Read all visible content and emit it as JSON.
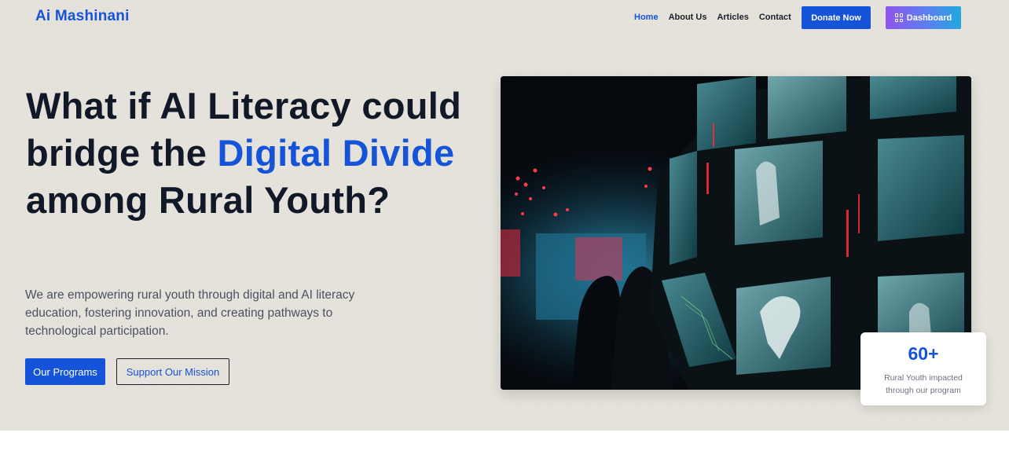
{
  "brand": {
    "name": "Ai Mashinani"
  },
  "nav": {
    "items": [
      {
        "label": "Home",
        "active": true
      },
      {
        "label": "About Us"
      },
      {
        "label": "Articles"
      },
      {
        "label": "Contact"
      }
    ],
    "donate_label": "Donate Now",
    "dashboard_label": "Dashboard"
  },
  "hero": {
    "headline_part1": "What if AI Literacy could bridge the ",
    "headline_highlight": "Digital Divide",
    "headline_part2": " among Rural Youth?",
    "subtext": "We are empowering rural youth through digital and AI literacy education, fostering innovation, and creating pathways to technological participation.",
    "primary_cta": "Our Programs",
    "secondary_cta": "Support Our Mission"
  },
  "stat": {
    "value": "60+",
    "label": "Rural Youth impacted through our program"
  },
  "colors": {
    "accent": "#1553d8",
    "background": "#f6f5f0",
    "heading": "#111827"
  },
  "icons": {
    "dashboard": "grid-icon"
  }
}
